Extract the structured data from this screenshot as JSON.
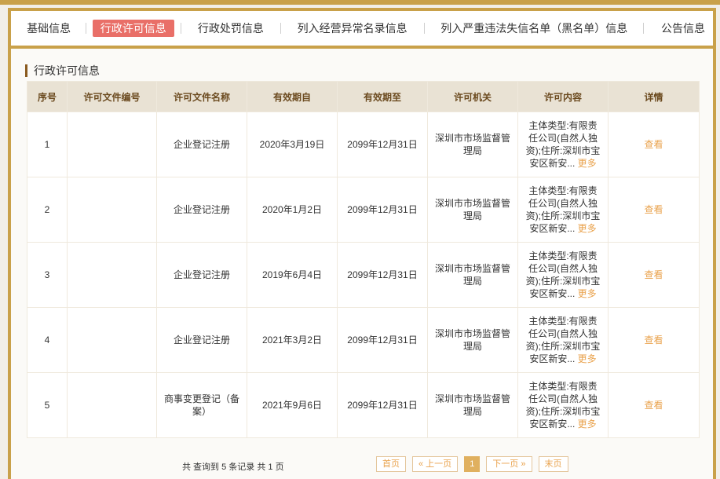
{
  "tabs": [
    {
      "label": "基础信息"
    },
    {
      "label": "行政许可信息"
    },
    {
      "label": "行政处罚信息"
    },
    {
      "label": "列入经营异常名录信息"
    },
    {
      "label": "列入严重违法失信名单（黑名单）信息"
    },
    {
      "label": "公告信息"
    }
  ],
  "active_tab": "行政许可信息",
  "section_title": "行政许可信息",
  "table": {
    "headers": [
      "序号",
      "许可文件编号",
      "许可文件名称",
      "有效期自",
      "有效期至",
      "许可机关",
      "许可内容",
      "详情"
    ],
    "rows": [
      {
        "no": "1",
        "file_no": "",
        "file_name": "企业登记注册",
        "from": "2020年3月19日",
        "to": "2099年12月31日",
        "authority": "深圳市市场监督管理局",
        "content": "主体类型:有限责任公司(自然人独资);住所:深圳市宝安区新安...",
        "more": "更多",
        "detail": "查看"
      },
      {
        "no": "2",
        "file_no": "",
        "file_name": "企业登记注册",
        "from": "2020年1月2日",
        "to": "2099年12月31日",
        "authority": "深圳市市场监督管理局",
        "content": "主体类型:有限责任公司(自然人独资);住所:深圳市宝安区新安...",
        "more": "更多",
        "detail": "查看"
      },
      {
        "no": "3",
        "file_no": "",
        "file_name": "企业登记注册",
        "from": "2019年6月4日",
        "to": "2099年12月31日",
        "authority": "深圳市市场监督管理局",
        "content": "主体类型:有限责任公司(自然人独资);住所:深圳市宝安区新安...",
        "more": "更多",
        "detail": "查看"
      },
      {
        "no": "4",
        "file_no": "",
        "file_name": "企业登记注册",
        "from": "2021年3月2日",
        "to": "2099年12月31日",
        "authority": "深圳市市场监督管理局",
        "content": "主体类型:有限责任公司(自然人独资);住所:深圳市宝安区新安...",
        "more": "更多",
        "detail": "查看"
      },
      {
        "no": "5",
        "file_no": "",
        "file_name": "商事变更登记（备案）",
        "from": "2021年9月6日",
        "to": "2099年12月31日",
        "authority": "深圳市市场监督管理局",
        "content": "主体类型:有限责任公司(自然人独资);住所:深圳市宝安区新安...",
        "more": "更多",
        "detail": "查看"
      }
    ]
  },
  "footer": {
    "summary": "共 查询到 5 条记录 共 1 页",
    "first": "首页",
    "prev": "« 上一页",
    "current": "1",
    "next": "下一页 »",
    "last": "末页"
  }
}
